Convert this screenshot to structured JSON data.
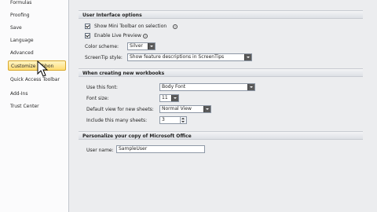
{
  "sidebar": {
    "items": [
      {
        "label": "Formulas"
      },
      {
        "label": "Proofing"
      },
      {
        "label": "Save"
      },
      {
        "label": "Language"
      },
      {
        "label": "Advanced"
      },
      {
        "label": "Customize Ribbon"
      },
      {
        "label": "Quick Access Toolbar"
      },
      {
        "label": "Add-Ins"
      },
      {
        "label": "Trust Center"
      }
    ],
    "selected_index": 5
  },
  "user_interface": {
    "header": "User Interface options",
    "show_mini_toolbar": {
      "label": "Show Mini Toolbar on selection",
      "checked": true
    },
    "enable_live_preview": {
      "label": "Enable Live Preview",
      "checked": true
    },
    "color_scheme": {
      "label": "Color scheme:",
      "value": "Silver"
    },
    "screentip_style": {
      "label": "ScreenTip style:",
      "value": "Show feature descriptions in ScreenTips"
    }
  },
  "new_workbooks": {
    "header": "When creating new workbooks",
    "font": {
      "label": "Use this font:",
      "value": "Body Font"
    },
    "font_size": {
      "label": "Font size:",
      "value": "11"
    },
    "default_view": {
      "label": "Default view for new sheets:",
      "value": "Normal View"
    },
    "sheets": {
      "label": "Include this many sheets:",
      "value": "3"
    }
  },
  "personalize": {
    "header": "Personalize your copy of Microsoft Office",
    "user_name": {
      "label": "User name:",
      "value": "SampleUser"
    }
  },
  "icons": {
    "info": "info-icon",
    "cursor": "mouse-pointer-icon"
  },
  "colors": {
    "selected_bg": "#ffdc72",
    "selected_border": "#d9a72c",
    "dropdown_button": "#5a5a5a"
  }
}
